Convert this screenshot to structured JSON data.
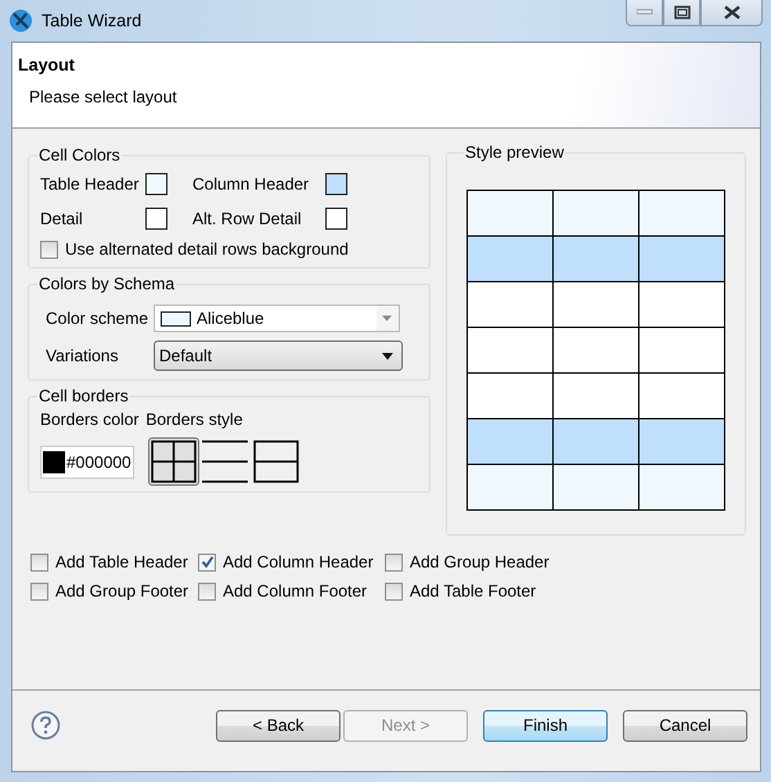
{
  "window": {
    "title": "Table Wizard"
  },
  "header": {
    "title": "Layout",
    "description": "Please select layout"
  },
  "cell_colors": {
    "title": "Cell Colors",
    "swatches": [
      {
        "label": "Table Header",
        "color": "#f0f8ff"
      },
      {
        "label": "Column Header",
        "color": "#bfdffc"
      },
      {
        "label": "Detail",
        "color": "#ffffff"
      },
      {
        "label": "Alt. Row Detail",
        "color": "#ffffff"
      }
    ],
    "alternate_rows": {
      "label": "Use alternated detail rows background",
      "checked": false
    }
  },
  "colors_by_schema": {
    "title": "Colors by Schema",
    "color_scheme": {
      "label": "Color scheme",
      "value": "Aliceblue",
      "color": "#f0f8ff"
    },
    "variations": {
      "label": "Variations",
      "value": "Default"
    }
  },
  "cell_borders": {
    "title": "Cell borders",
    "color_label": "Borders color",
    "style_label": "Borders style",
    "color_value": "#000000",
    "color": "#000000",
    "styles": [
      {
        "kind": "grid",
        "selected": true
      },
      {
        "kind": "horizontal",
        "selected": false
      },
      {
        "kind": "box",
        "selected": false
      }
    ]
  },
  "style_preview": {
    "title": "Style preview",
    "rows": [
      {
        "color": "#f0f8ff"
      },
      {
        "color": "#bfdffc"
      },
      {
        "color": "#ffffff"
      },
      {
        "color": "#ffffff"
      },
      {
        "color": "#ffffff"
      },
      {
        "color": "#bfdffc"
      },
      {
        "color": "#f0f8ff"
      }
    ]
  },
  "options": [
    {
      "label": "Add Table Header",
      "checked": false
    },
    {
      "label": "Add Column Header",
      "checked": true
    },
    {
      "label": "Add Group Header",
      "checked": false
    },
    {
      "label": "Add Group Footer",
      "checked": false
    },
    {
      "label": "Add Column Footer",
      "checked": false
    },
    {
      "label": "Add Table Footer",
      "checked": false
    }
  ],
  "buttons": [
    {
      "label": "< Back",
      "disabled": false,
      "default": false
    },
    {
      "label": "Next >",
      "disabled": true,
      "default": false
    },
    {
      "label": "Finish",
      "disabled": false,
      "default": true
    },
    {
      "label": "Cancel",
      "disabled": false,
      "default": false
    }
  ]
}
